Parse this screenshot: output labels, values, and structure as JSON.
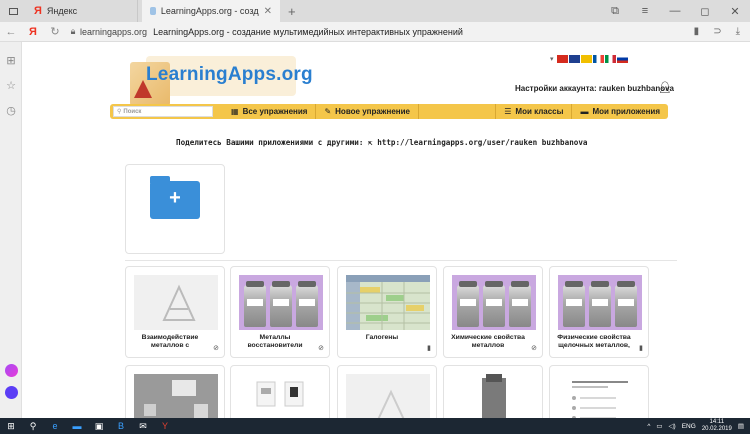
{
  "browser": {
    "tabs": [
      {
        "label": "Яндекс",
        "active": false
      },
      {
        "label": "LearningApps.org - созд",
        "active": true
      }
    ],
    "new_tab": "+",
    "window_controls": {
      "pin": "⧉",
      "menu": "≡",
      "minimize": "—",
      "maximize": "◻",
      "close": "✕"
    },
    "address": {
      "domain": "learningapps.org",
      "title": "LearningApps.org - создание мультимедийных интерактивных упражнений"
    }
  },
  "site": {
    "logo": "LearningApps.org",
    "settings_label": "Настройки аккаунта: rauken buzhbanova",
    "flag_colors": [
      "#d52b1e",
      "#1f3f8f",
      "#f1bf00",
      "#0055a4",
      "#009246",
      "#ce2b37"
    ],
    "menu": {
      "search_placeholder": "Поиск",
      "all_apps": "Все упражнения",
      "new_app": "Новое упражнение",
      "my_classes": "Мои классы",
      "my_apps": "Мои приложения"
    },
    "share_text": "Поделитесь Вашими приложениями с другими:",
    "share_url": "http://learningapps.org/user/rauken buzhbanova",
    "new_folder_symbol": "+",
    "apps": [
      {
        "title": "Взаимодействие металлов с",
        "icon": "eye-off-icon",
        "thumb": "generic"
      },
      {
        "title": "Металлы восстановители",
        "icon": "eye-off-icon",
        "thumb": "jars"
      },
      {
        "title": "Галогены",
        "icon": "bookmark-icon",
        "thumb": "sheet"
      },
      {
        "title": "Химические свойства металлов",
        "icon": "eye-off-icon",
        "thumb": "jars"
      },
      {
        "title": "Физические свойства щелочных металлов,",
        "icon": "bookmark-icon",
        "thumb": "jars"
      }
    ],
    "accent_color": "#f4c64a",
    "logo_color": "#2a7fd0"
  },
  "taskbar": {
    "lang": "ENG",
    "time": "14:11",
    "date": "20.02.2019"
  }
}
